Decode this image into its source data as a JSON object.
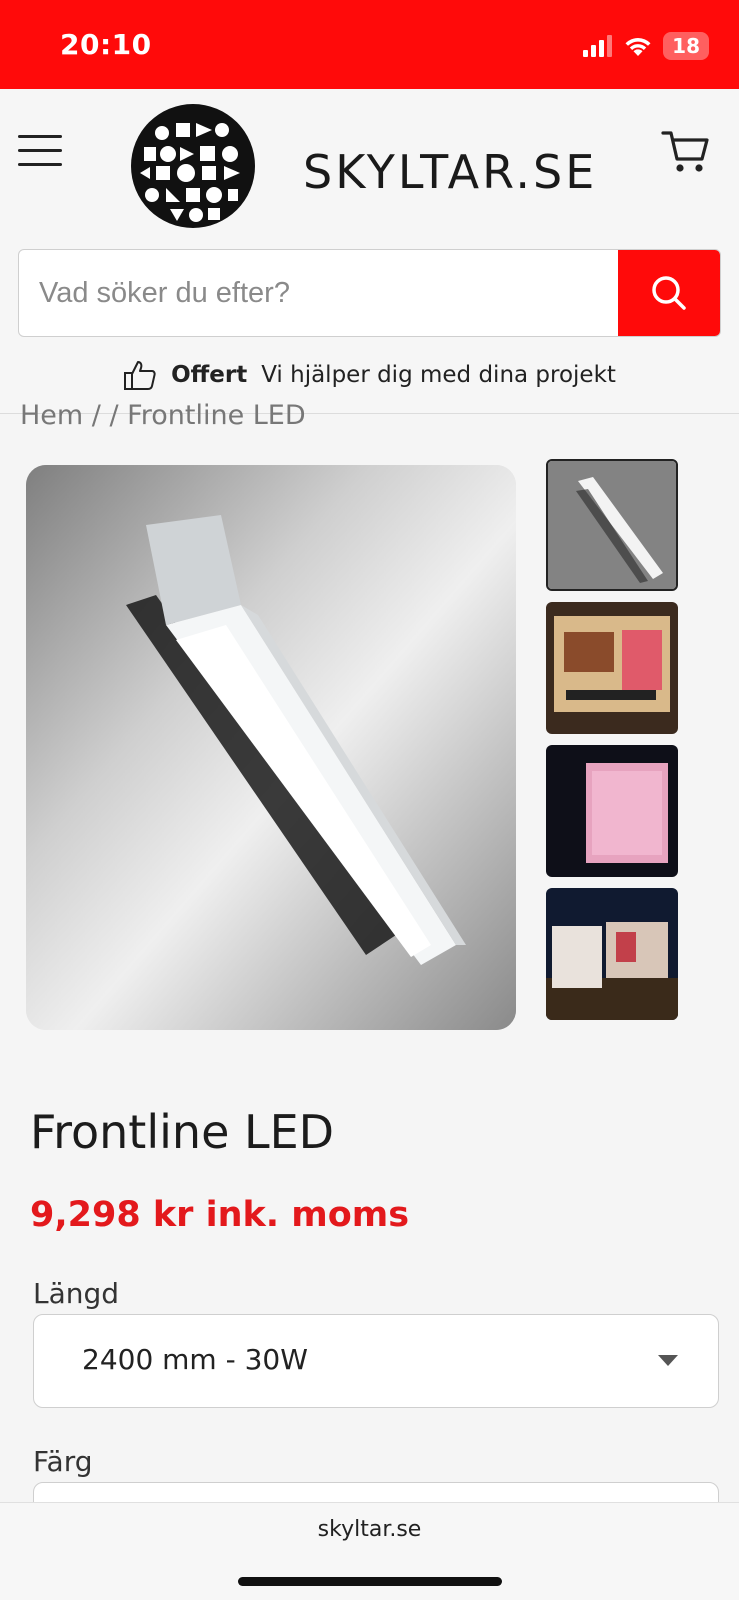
{
  "status_bar": {
    "time": "20:10",
    "battery": "18",
    "icons": [
      "signal-icon",
      "wifi-icon",
      "battery-icon"
    ]
  },
  "header": {
    "logo_text": "SKYLTAR.SE",
    "icons": [
      "menu-icon",
      "logo-globe-icon",
      "cart-icon"
    ],
    "search": {
      "placeholder": "Vad söker du efter?",
      "value": "",
      "icon": "search-icon"
    },
    "offer": {
      "icon": "thumbs-up-icon",
      "label": "Offert",
      "text": "Vi hjälper dig med dina projekt"
    }
  },
  "breadcrumb": "Hem / / Frontline LED",
  "gallery": {
    "thumbnail_count": 4,
    "active_thumbnail": 1
  },
  "product": {
    "title": "Frontline LED",
    "price": "9,298 kr ink. moms",
    "options": [
      {
        "label": "Längd",
        "value": "2400 mm - 30W"
      },
      {
        "label": "Färg",
        "value": ""
      }
    ]
  },
  "browser": {
    "url": "skyltar.se"
  },
  "colors": {
    "brand_red": "#ff0a0a",
    "price_red": "#e3191c"
  }
}
